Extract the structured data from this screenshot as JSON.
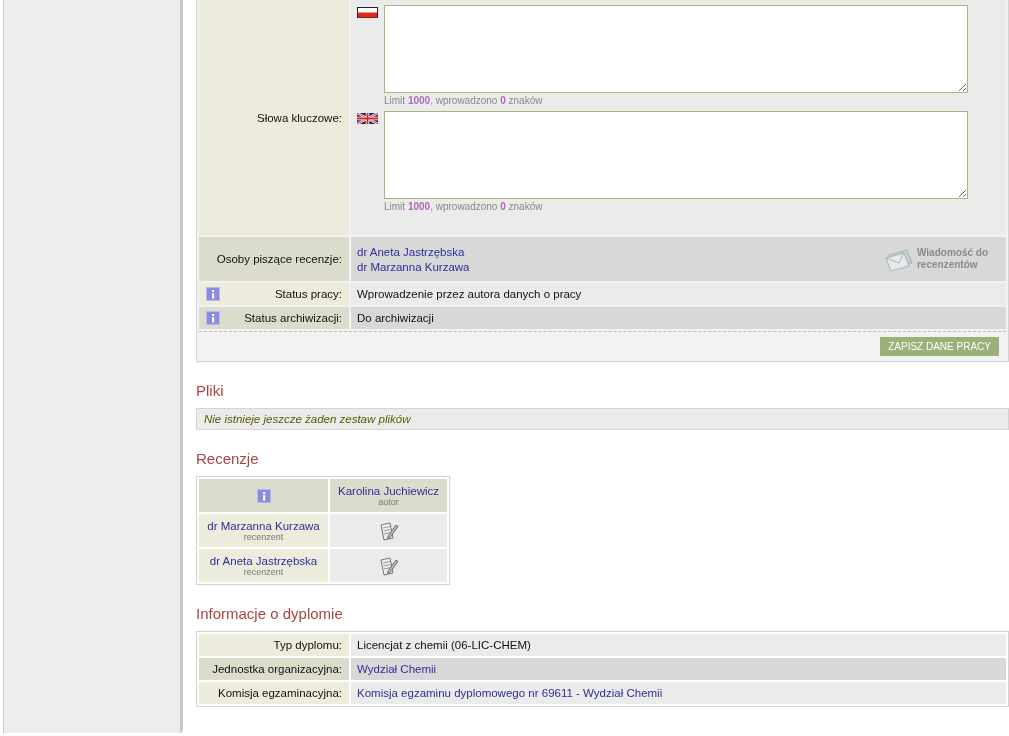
{
  "keywords": {
    "label": "Słowa kluczowe:",
    "fields": [
      {
        "kind": "pl",
        "counter": "Limit **1000**, wprowadzono **0** znaków"
      },
      {
        "kind": "gb",
        "counter": "Limit **1000**, wprowadzono **0** znaków"
      }
    ]
  },
  "reviewers": {
    "label": "Osoby piszące recenzje:",
    "names": [
      "dr Aneta Jastrzębska",
      "dr Marzanna Kurzawa"
    ],
    "message_button": [
      "Wiadomość do",
      "recenzentów"
    ]
  },
  "status_rows": [
    {
      "label": "Status pracy:",
      "value": "Wprowadzenie przez autora danych o pracy"
    },
    {
      "label": "Status archiwizacji:",
      "value": "Do archiwizacji"
    }
  ],
  "save_button": "ZAPISZ DANE PRACY",
  "files": {
    "heading": "Pliki",
    "empty_message": "Nie istnieje jeszcze żaden zestaw plików"
  },
  "reviews": {
    "heading": "Recenzje",
    "author": {
      "name": "Karolina Juchiewicz",
      "role": "autor"
    },
    "rows": [
      {
        "name": "dr Marzanna Kurzawa",
        "role": "recenzent"
      },
      {
        "name": "dr Aneta Jastrzębska",
        "role": "recenzent"
      }
    ]
  },
  "diploma": {
    "heading": "Informacje o dyplomie",
    "rows": [
      {
        "label": "Typ dyplomu:",
        "value": "Licencjat z chemii (06-LIC-CHEM)",
        "kind": "text"
      },
      {
        "label": "Jednostka organizacyjna:",
        "value": "Wydział Chemii",
        "kind": "link"
      },
      {
        "label": "Komisja egzaminacyjna:",
        "value": "Komisja egzaminu dyplomowego nr 69611 - Wydział Chemii",
        "kind": "link"
      }
    ]
  }
}
